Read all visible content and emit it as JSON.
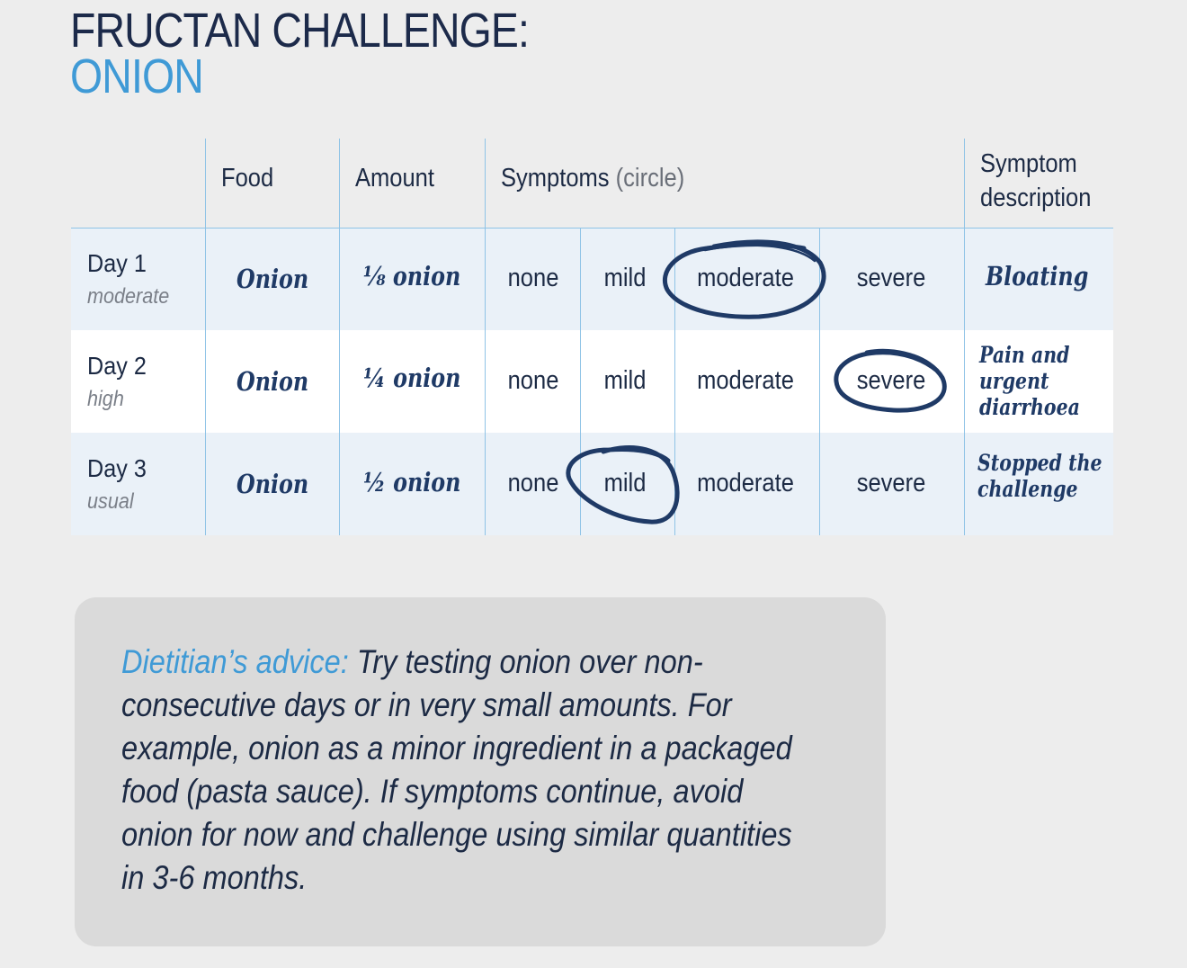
{
  "title": {
    "line1": "FRUCTAN CHALLENGE:",
    "line2": "ONION"
  },
  "table": {
    "headers": {
      "food": "Food",
      "amount": "Amount",
      "symptoms": "Symptoms",
      "symptoms_note": "(circle)",
      "description": "Symptom description"
    },
    "severity_options": [
      "none",
      "mild",
      "moderate",
      "severe"
    ],
    "rows": [
      {
        "day": "Day 1",
        "level": "moderate",
        "food": "Onion",
        "amount_fraction": "⅛",
        "amount_text": "onion",
        "circled": "moderate",
        "description": "Bloating"
      },
      {
        "day": "Day 2",
        "level": "high",
        "food": "Onion",
        "amount_fraction": "¼",
        "amount_text": "onion",
        "circled": "severe",
        "description": "Pain and urgent diarrhoea"
      },
      {
        "day": "Day 3",
        "level": "usual",
        "food": "Onion",
        "amount_fraction": "½",
        "amount_text": "onion",
        "circled": "mild",
        "description": "Stopped the challenge"
      }
    ]
  },
  "advice": {
    "label": "Dietitian’s advice:",
    "text": "Try testing onion over non-consecutive days or in very small amounts. For example, onion as a minor ingredient in a packaged food (pasta sauce). If symptoms continue, avoid onion for now and challenge using similar quantities in 3-6 months."
  },
  "colors": {
    "navy": "#1c2a4a",
    "accent_blue": "#3f9ad6",
    "ink": "#1f3a66",
    "grid_line": "#8fc3e6"
  }
}
